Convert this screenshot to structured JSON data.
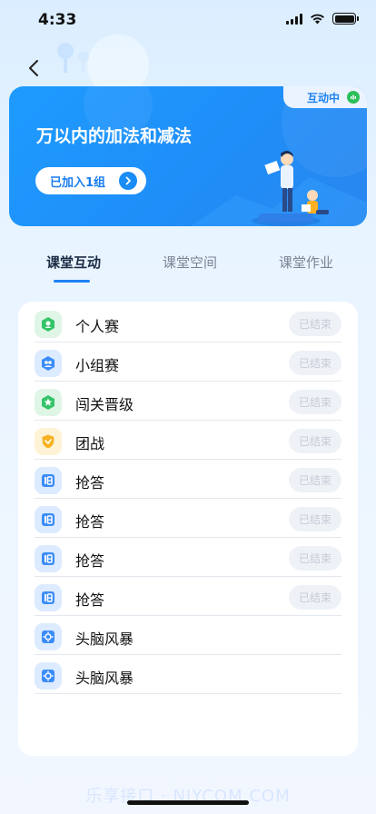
{
  "status_bar": {
    "time": "4:33"
  },
  "banner": {
    "title": "万以内的加法和减法",
    "group_label": "已加入1组",
    "status_label": "互动中"
  },
  "tabs": [
    {
      "label": "课堂互动",
      "active": true
    },
    {
      "label": "课堂空间",
      "active": false
    },
    {
      "label": "课堂作业",
      "active": false
    }
  ],
  "list": [
    {
      "label": "个人赛",
      "badge": "已结束",
      "icon": "personal-contest-icon"
    },
    {
      "label": "小组赛",
      "badge": "已结束",
      "icon": "group-contest-icon"
    },
    {
      "label": "闯关晋级",
      "badge": "已结束",
      "icon": "level-up-icon"
    },
    {
      "label": "团战",
      "badge": "已结束",
      "icon": "team-battle-icon"
    },
    {
      "label": "抢答",
      "badge": "已结束",
      "icon": "quick-answer-icon"
    },
    {
      "label": "抢答",
      "badge": "已结束",
      "icon": "quick-answer-icon"
    },
    {
      "label": "抢答",
      "badge": "已结束",
      "icon": "quick-answer-icon"
    },
    {
      "label": "抢答",
      "badge": "已结束",
      "icon": "quick-answer-icon"
    },
    {
      "label": "头脑风暴",
      "badge": "",
      "icon": "brainstorm-icon"
    },
    {
      "label": "头脑风暴",
      "badge": "",
      "icon": "brainstorm-icon"
    }
  ],
  "watermark": "乐享接口 · NIYCOM.COM",
  "colors": {
    "accent": "#1f82f3",
    "banner": "#1e9bff",
    "live": "#2dbf5a",
    "badge_bg": "#eef2f7",
    "badge_text": "#c5ccd6"
  }
}
